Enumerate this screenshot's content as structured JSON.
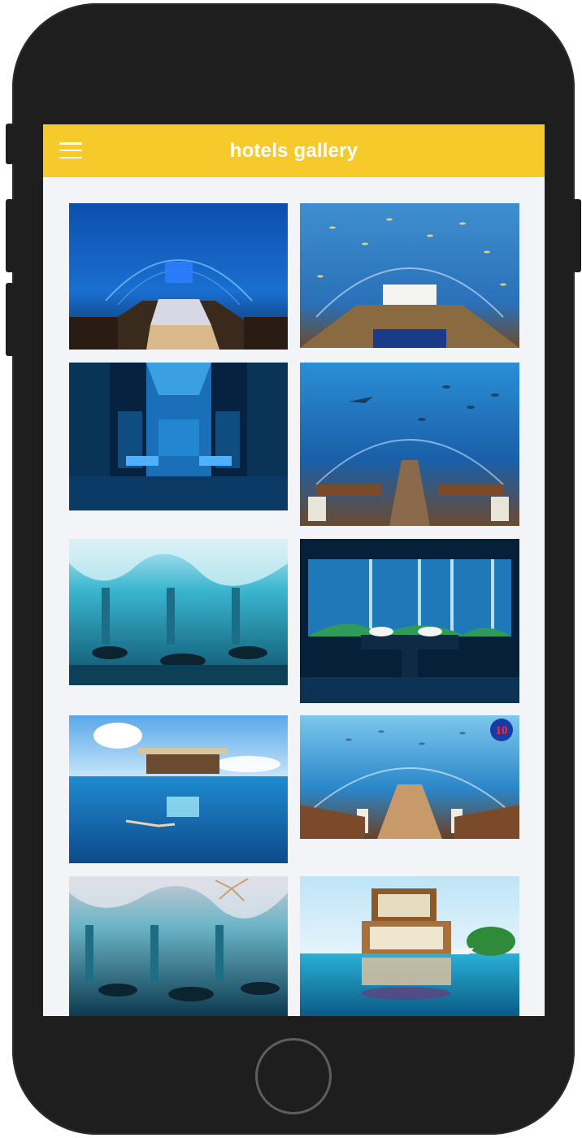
{
  "app_bar": {
    "title": "hotels gallery",
    "menu_icon": "hamburger-menu-icon",
    "background_color": "#f7ca2c"
  },
  "gallery": {
    "items": [
      {
        "scene": "underwater-bedroom-tunnel",
        "column": "left"
      },
      {
        "scene": "underwater-bedroom-fish-tunnel",
        "column": "right"
      },
      {
        "scene": "underwater-glass-suite",
        "column": "left"
      },
      {
        "scene": "underwater-restaurant-shark",
        "column": "right"
      },
      {
        "scene": "underwater-restaurant-ceiling",
        "column": "left"
      },
      {
        "scene": "underwater-bathroom",
        "column": "right"
      },
      {
        "scene": "floating-villa-swimmer",
        "column": "left"
      },
      {
        "scene": "underwater-dining-tunnel",
        "column": "right",
        "badge": "10"
      },
      {
        "scene": "underwater-restaurant-chandelier",
        "column": "left"
      },
      {
        "scene": "floating-seahorse-villa",
        "column": "right"
      }
    ]
  },
  "colors": {
    "phone_body": "#1e1e1e",
    "screen_background": "#f3f4f8",
    "ocean_deep": "#0a3f8c",
    "ocean_light": "#3fb4e6"
  }
}
